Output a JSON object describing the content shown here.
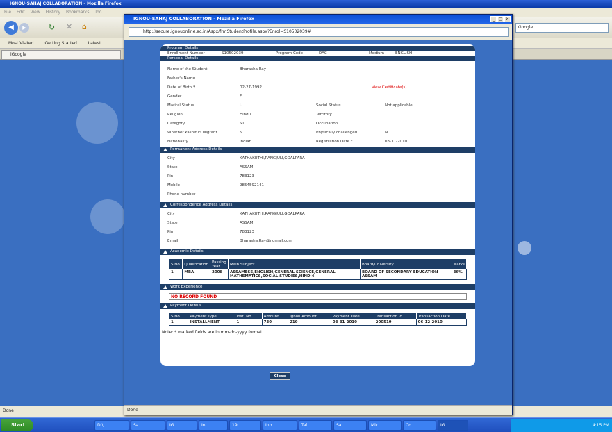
{
  "bg": {
    "title": "IGNOU-SAHAJ COLLABORATION - Mozilla Firefox",
    "menu": [
      "File",
      "Edit",
      "View",
      "History",
      "Bookmarks",
      "Too"
    ],
    "bookmarks": [
      "Most Visited",
      "Getting Started",
      "Latest"
    ],
    "tab": "iGoogle",
    "search": "Google",
    "status": "Done"
  },
  "popup": {
    "title": "IGNOU-SAHAJ COLLABORATION - Mozilla Firefox",
    "url": "http://secure.ignouonline.ac.in/Aspx/frmStudentProfile.aspx?Enrol=S10502039#",
    "status": "Done"
  },
  "program": {
    "header": "Program Details",
    "enroll_label": "Enrollment Number",
    "enroll": "S10502039",
    "code_label": "Program Code",
    "code": "DAC",
    "medium_label": "Medium",
    "medium": "ENGLISH"
  },
  "personal": {
    "header": "Personal Details",
    "name_l": "Name of the Student",
    "name": "Bharasha Ray",
    "father_l": "Father's Name",
    "dob_l": "Date of Birth *",
    "dob": "02-27-1992",
    "view_cert": "View Certificate(s)",
    "gender_l": "Gender",
    "gender": "F",
    "marital_l": "Marital Status",
    "marital": "U",
    "social_l": "Social Status",
    "social": "Not applicable",
    "religion_l": "Religion",
    "religion": "Hindu",
    "territory_l": "Territory",
    "category_l": "Category",
    "category": "ST",
    "occupation_l": "Occupation",
    "kashmiri_l": "Whether kashmiri Migrant",
    "kashmiri": "N",
    "phys_l": "Physically challenged",
    "phys": "N",
    "nationality_l": "Nationality",
    "nationality": "Indian",
    "regdate_l": "Registration Date *",
    "regdate": "03-31-2010"
  },
  "permanent": {
    "header": "Permanent Address Details",
    "city_l": "City",
    "city": "KATHAKUTHI,RANGJULI,GOALPARA",
    "state_l": "State",
    "state": "ASSAM",
    "pin_l": "Pin",
    "pin": "783123",
    "mobile_l": "Mobile",
    "mobile": "9854592141",
    "phone_l": "Phone number",
    "phone": "- -"
  },
  "corr": {
    "header": "Correspondence Address Details",
    "city_l": "City",
    "city": "KATHAKUTHI,RANGJULI,GOALPARA",
    "state_l": "State",
    "state": "ASSAM",
    "pin_l": "Pin",
    "pin": "783123",
    "email_l": "Email",
    "email": "Bharasha.Ray@nomail.com"
  },
  "academic": {
    "header": "Academic Details",
    "cols": [
      "S.No.",
      "Qualification",
      "Passing Year",
      "Main Subject",
      "Board/University",
      "Marks"
    ],
    "row": [
      "1",
      "MBA",
      "2008",
      "ASSAMESE,ENGLISH,GENERAL SCIENCE,GENERAL MATHEMATICS,SOCIAL STUDIES,HINDI4",
      "BOARD OF SECONDARY EDUCATION ASSAM",
      "36%"
    ]
  },
  "work": {
    "header": "Work Experience",
    "none": "NO RECORD FOUND"
  },
  "payment": {
    "header": "Payment Details",
    "cols": [
      "S.No.",
      "Payment Type",
      "Inst. No.",
      "Amount",
      "Ignou Amount",
      "Payment Date",
      "Transaction Id",
      "Transaction Date"
    ],
    "row": [
      "1",
      "INSTALLMENT",
      "1",
      "730",
      "219",
      "03-31-2010",
      "200519",
      "06-12-2010"
    ]
  },
  "note": "Note: * marked fields are in mm-dd-yyyy format",
  "close": "Close",
  "taskbar": {
    "start": "Start",
    "items": [
      "D:\\...",
      "Sa...",
      "IG...",
      "In...",
      "19...",
      "Inb...",
      "Tal...",
      "Sa...",
      "Mic...",
      "Co...",
      "IG..."
    ],
    "clock": "4:15 PM"
  }
}
